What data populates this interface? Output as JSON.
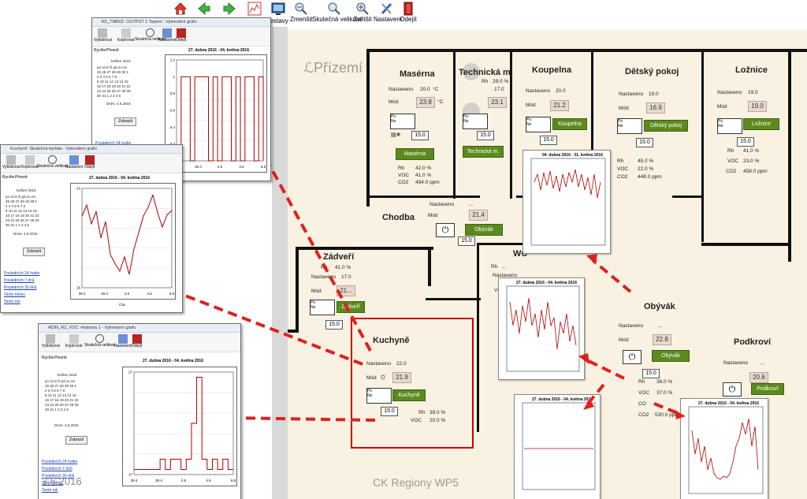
{
  "toolbar": {
    "items": [
      {
        "label": "",
        "icon": "home-icon"
      },
      {
        "label": "",
        "icon": "arrow-left-icon"
      },
      {
        "label": "",
        "icon": "arrow-right-icon"
      },
      {
        "label": "",
        "icon": "chart-icon"
      },
      {
        "label": "",
        "icon": "monitor-icon"
      },
      {
        "label": "...estavy",
        "icon": "layout-icon"
      },
      {
        "label": "Zmenšit",
        "icon": "zoom-out-icon"
      },
      {
        "label": "Skutečná velikost",
        "icon": "zoom-reset-icon"
      },
      {
        "label": "Zvětšit",
        "icon": "zoom-in-icon"
      },
      {
        "label": "Nastavení",
        "icon": "tools-icon"
      },
      {
        "label": "Odejít",
        "icon": "exit-door-icon"
      }
    ]
  },
  "plan": {
    "floor_label": "Přízemí",
    "footer_label": "CK Regiony WP5",
    "rooms": {
      "maserna": {
        "title": "Masérna",
        "nastaveno_label": "Nastaveno",
        "nastaveno": "20.0",
        "mod_label": "Mód",
        "current": "23.8",
        "unit": "°C",
        "set": "15.0",
        "button": "Masérna",
        "rh": "42.0 %",
        "voc": "41.0 %",
        "co2": "494.0 ppm"
      },
      "technicka": {
        "title": "Technická m.",
        "rh": "29.0 %",
        "nastaveno": "17.0",
        "current": "23.1",
        "set": "15.0",
        "button": "Technická m."
      },
      "koupelna": {
        "title": "Koupelna",
        "nastaveno": "20.0",
        "current": "21.2",
        "set": "15.0",
        "button": "Koupelna"
      },
      "detsky": {
        "title": "Dětský pokoj",
        "nastaveno": "19.0",
        "current": "16.9",
        "set": "15.0",
        "button": "Dětský pokoj",
        "rh": "45.0 %",
        "voc": "22.0 %",
        "co2": "448.0 ppm"
      },
      "loznice": {
        "title": "Ložnice",
        "nastaveno": "19.0",
        "current": "19.0",
        "set": "15.0",
        "button": "Ložnice",
        "rh": "41.0 %",
        "voc": "23.0 %",
        "co2": "458.0 ppm"
      },
      "chodba": {
        "title": "Chodba",
        "nastaveno": "...",
        "current": "21.4",
        "set": "15.0",
        "button": "Obývák"
      },
      "zadveri": {
        "title": "Zádveří",
        "rh": "41.0 %",
        "nastaveno": "17.0",
        "current": "21...",
        "set": "15.0",
        "button": "Zádveří"
      },
      "kuchyne": {
        "title": "Kuchyně",
        "nastaveno": "22.0",
        "current": "21.9",
        "set": "15.0",
        "button": "Kuchyně",
        "rh": "39.0 %",
        "voc": "20.0 %"
      },
      "wc": {
        "title": "WC",
        "nastaveno": "...",
        "rh": "...",
        "voc": "...",
        "current": "..."
      },
      "obyvak": {
        "title": "Obývák",
        "nastaveno": "...",
        "current": "22.8",
        "set": "15.0",
        "button": "Obývák",
        "rh": "38.0 %",
        "voc": "37.0 %",
        "co": "...",
        "co2": "530.0 ppm"
      },
      "podkrovi": {
        "title": "Podkroví",
        "nastaveno": "...",
        "current": "20.6",
        "set": "15.0",
        "button": "Podkroví"
      }
    },
    "labels": {
      "nastaveno": "Nastaveno",
      "mod": "Mód",
      "rh": "Rh",
      "voc": "VOC",
      "co2": "CO2",
      "co": "CO",
      "deg": "°C"
    }
  },
  "windows": {
    "w1": {
      "title": "R2_TMR02: OUTPUT 1 Topení - Vykreslení grafu",
      "chart_title": "27. dubna 2016 - 04. května 2016",
      "month": "květen 2016",
      "today": "Dnes: 4.5.2016",
      "button": "Zobrazit",
      "link": "Posledních 24 hodin"
    },
    "w2": {
      "title": "Kuchyně: Skutečná teplota - Vykreslení grafu",
      "chart_title": "27. dubna 2016 - 04. května 2016",
      "month": "květen 2016",
      "today": "Dnes: 4.5.2016",
      "button": "Zobrazit",
      "links": [
        "Posledních 24 hodin",
        "Posledních 7 dnů",
        "Posledních 30 dnů",
        "Tento měsíc",
        "Tento rok"
      ],
      "xlabel": "Čas"
    },
    "w3": {
      "title": "ADIN_R2_VOC: Hodnota 1 - Vykreslení grafu",
      "chart_title": "27. dubna 2016 - 04. května 2016",
      "month": "květen 2016",
      "today": "Dnes: 4.5.2016",
      "button": "Zobrazit",
      "links": [
        "Posledních 24 hodin",
        "Posledních 7 dnů",
        "Posledních 30 dnů",
        "Tento měsíc",
        "Tento rok"
      ],
      "date_overlay": "3.6.2016",
      "xlabel": "Čas"
    },
    "tools": {
      "export": "Vytisknout",
      "copy": "Kopírovat",
      "real": "Skutečná velikost",
      "settings": "Nastavení",
      "exit": "Odejít"
    },
    "tabs": {
      "quick": "Rychle",
      "exact": "Přesně"
    },
    "weekdays": [
      "po",
      "út",
      "st",
      "čt",
      "pá",
      "so",
      "ne"
    ],
    "calendar": [
      "25 26 27 28 29 30 1",
      "2 3 4 5 6 7 8",
      "9 10 11 12 13 14 15",
      "16 17 18 19 20 21 22",
      "23 24 25 26 27 28 29",
      "30 31 1 2 3 4 5"
    ]
  },
  "mini_charts": {
    "koupelna": {
      "title": "04. dubna 2016 - 31. května 2016"
    },
    "wc": {
      "title": "27. dubna 2016 - 04. května 2016"
    },
    "obyvak": {
      "title": "27. dubna 2016 - 04. května 2016"
    },
    "podkrovi": {
      "title": "27. dubna 2016 - 04. května 2016"
    }
  },
  "chart_data": [
    {
      "type": "line",
      "title": "27. dubna 2016 - 04. května 2016",
      "x": [
        "28.4",
        "30.4",
        "2.5",
        "4.5",
        "6.5"
      ],
      "ylim": [
        0,
        1.2
      ],
      "yticks": [
        0,
        0.2,
        0.4,
        0.6,
        0.8,
        1.0,
        1.2
      ],
      "series": [
        {
          "values": [
            0,
            1,
            1,
            0,
            1,
            1,
            1,
            0,
            1,
            0,
            1,
            1,
            0,
            1,
            0,
            1,
            1,
            0,
            1,
            0
          ]
        }
      ]
    },
    {
      "type": "line",
      "title": "27. dubna 2016 - 04. května 2016",
      "xlabel": "Čas",
      "x": [
        "28.4",
        "30.4",
        "2.5",
        "4.5",
        "6.5"
      ],
      "ylim": [
        15,
        24
      ],
      "series": [
        {
          "values": [
            21.5,
            22.5,
            20.8,
            21.9,
            19.5,
            21.0,
            18.0,
            17.2,
            16.5,
            17.8,
            16.2,
            18.5,
            20.0,
            21.5,
            22.3,
            23.4,
            21.8,
            20.5,
            21.6,
            22.0
          ]
        }
      ]
    },
    {
      "type": "line",
      "title": "27. dubna 2016 - 04. května 2016",
      "xlabel": "Čas",
      "x": [
        "28.4",
        "30.4",
        "2.5",
        "4.5",
        "6.5"
      ],
      "ylim": [
        17,
        27
      ],
      "series": [
        {
          "values": [
            17.5,
            17.5,
            17.5,
            17.5,
            17.5,
            18.5,
            17.5,
            18.5,
            18.5,
            17.5,
            18.5,
            22.0,
            26.5,
            18.5,
            17.5,
            18.5,
            17.5,
            18.5,
            17.5,
            17.5
          ]
        }
      ]
    }
  ]
}
